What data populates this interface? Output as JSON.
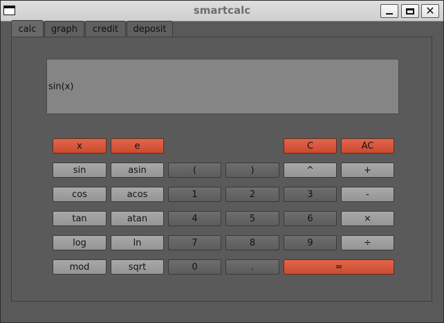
{
  "window": {
    "title": "smartcalc",
    "close_glyph": "✕",
    "icons": [
      "window-menu-icon",
      "minimize-icon",
      "maximize-icon",
      "close-icon"
    ]
  },
  "tabs": [
    {
      "label": "calc",
      "active": true
    },
    {
      "label": "graph",
      "active": false
    },
    {
      "label": "credit",
      "active": false
    },
    {
      "label": "deposit",
      "active": false
    }
  ],
  "display": {
    "value": "sin(x)"
  },
  "keypad": {
    "x": "x",
    "e": "e",
    "clear": "C",
    "all_clear": "AC",
    "sin": "sin",
    "asin": "asin",
    "open_paren": "(",
    "close_paren": ")",
    "pow": "^",
    "plus": "+",
    "cos": "cos",
    "acos": "acos",
    "one": "1",
    "two": "2",
    "three": "3",
    "minus": "-",
    "tan": "tan",
    "atan": "atan",
    "four": "4",
    "five": "5",
    "six": "6",
    "multiply": "×",
    "log": "log",
    "ln": "ln",
    "seven": "7",
    "eight": "8",
    "nine": "9",
    "divide": "÷",
    "mod": "mod",
    "sqrt": "sqrt",
    "zero": "0",
    "dot": ".",
    "equals": "="
  },
  "colors": {
    "accent_red": "#d9553a",
    "background": "#595959",
    "display_bg": "#858585"
  }
}
